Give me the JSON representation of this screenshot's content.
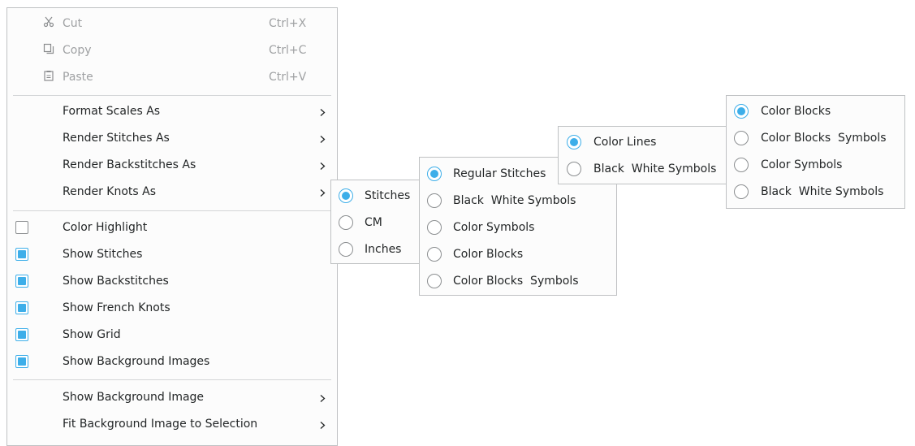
{
  "main_menu": {
    "cut": {
      "label": "Cut",
      "shortcut": "Ctrl+X",
      "icon": "scissors-icon"
    },
    "copy": {
      "label": "Copy",
      "shortcut": "Ctrl+C",
      "icon": "copy-icon"
    },
    "paste": {
      "label": "Paste",
      "shortcut": "Ctrl+V",
      "icon": "clipboard-icon"
    },
    "format_scales_as": "Format Scales As",
    "render_stitches_as": "Render Stitches As",
    "render_backstitches_as": "Render Backstitches As",
    "render_knots_as": "Render Knots As",
    "toggles": [
      {
        "label": "Color Highlight",
        "checked": false
      },
      {
        "label": "Show Stitches",
        "checked": true
      },
      {
        "label": "Show Backstitches",
        "checked": true
      },
      {
        "label": "Show French Knots",
        "checked": true
      },
      {
        "label": "Show Grid",
        "checked": true
      },
      {
        "label": "Show Background Images",
        "checked": true
      }
    ],
    "show_background_image": "Show Background Image",
    "fit_background_image": "Fit Background Image to Selection"
  },
  "submenus": {
    "format_scales": {
      "options": [
        "Stitches",
        "CM",
        "Inches"
      ],
      "selected": "Stitches"
    },
    "render_stitches": {
      "options": [
        "Regular Stitches",
        "Black  White Symbols",
        "Color Symbols",
        "Color Blocks",
        "Color Blocks  Symbols"
      ],
      "selected": "Regular Stitches"
    },
    "render_backstitches": {
      "options": [
        "Color Lines",
        "Black  White Symbols"
      ],
      "selected": "Color Lines"
    },
    "render_knots": {
      "options": [
        "Color Blocks",
        "Color Blocks  Symbols",
        "Color Symbols",
        "Black  White Symbols"
      ],
      "selected": "Color Blocks"
    }
  },
  "colors": {
    "accent": "#3daee9",
    "menu_bg": "#fcfcfc",
    "border": "#bfc1c3",
    "text": "#232627",
    "disabled_text": "#9fa1a3"
  }
}
